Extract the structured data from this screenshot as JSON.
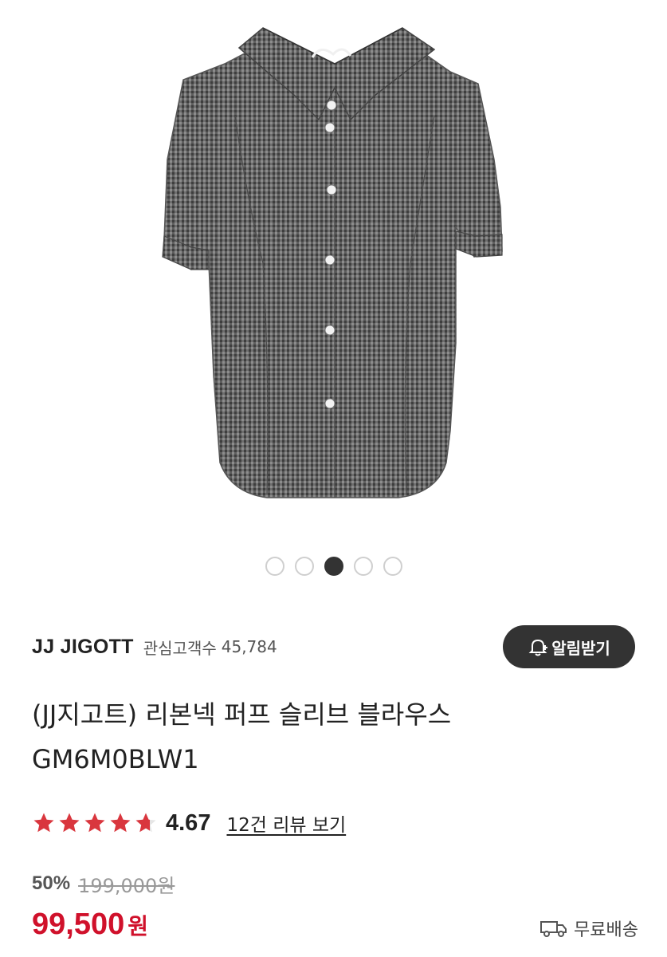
{
  "gallery": {
    "image_alt": "gray gingham puff sleeve blouse",
    "dots": [
      false,
      false,
      true,
      false,
      false
    ]
  },
  "brand": {
    "name": "JJ JIGOTT",
    "fans_label": "관심고객수",
    "fans_count": "45,784",
    "alert_label": "알림받기",
    "alert_icon": "bell-plus-icon"
  },
  "product": {
    "title_line1": "(JJ지고트) 리본넥 퍼프 슬리브 블라우스",
    "title_line2": "GM6M0BLW1"
  },
  "rating": {
    "stars": 4.67,
    "value": "4.67",
    "review_link": "12건 리뷰 보기",
    "star_color": "#d9363e"
  },
  "price": {
    "discount": "50%",
    "original": "199,000원",
    "sale": "99,500",
    "currency": "원",
    "sale_color": "#d0112b"
  },
  "shipping": {
    "label": "무료배송",
    "icon": "truck-icon"
  }
}
